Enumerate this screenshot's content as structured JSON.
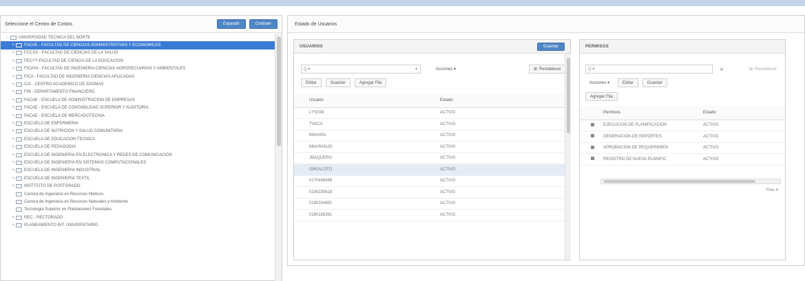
{
  "left_panel": {
    "title": "Seleccione el Centro de Costos",
    "expand_label": "Expandir",
    "collapse_label": "Contraer",
    "tree_items": [
      {
        "label": "UNIVERSIDAD TECNICA DEL NORTE",
        "toggle": "−",
        "level": 0,
        "selected": false
      },
      {
        "label": "FACAE - FACULTAD DE CIENCIAS ADMINISTRATIVAS Y ECONOMICAS",
        "toggle": "+",
        "level": 1,
        "selected": true
      },
      {
        "label": "FCCSS - FACULTAD DE CIENCIAS DE LA SALUD",
        "toggle": "+",
        "level": 1,
        "selected": false
      },
      {
        "label": "FECYT-FACULTAD DE CIENCIA DE LA EDUCACION",
        "toggle": "+",
        "level": 1,
        "selected": false
      },
      {
        "label": "FICAYA - FACULTAD DE INGENIERIA CIENCIAS AGROPECUARIAS Y AMBIENTALES",
        "toggle": "+",
        "level": 1,
        "selected": false
      },
      {
        "label": "FICA - FACULTAD DE INGENIERIA CIENCIAS APLICADAS",
        "toggle": "+",
        "level": 1,
        "selected": false
      },
      {
        "label": "CAI - CENTRO ACADEMICO DE IDIOMAS",
        "toggle": "+",
        "level": 1,
        "selected": false
      },
      {
        "label": "FIN - DEPARTAMENTO FINANCIERO",
        "toggle": "+",
        "level": 1,
        "selected": false
      },
      {
        "label": "FACAE - ESCUELA DE ADMINISTRACION DE EMPRESAS",
        "toggle": "+",
        "level": 1,
        "selected": false
      },
      {
        "label": "FACAE - ESCUELA DE CONTABILIDAD SUPERIOR Y AUDITORIA",
        "toggle": "+",
        "level": 1,
        "selected": false
      },
      {
        "label": "FACAE - ESCUELA DE MERCADOTECNIA",
        "toggle": "+",
        "level": 1,
        "selected": false
      },
      {
        "label": "ESCUELA DE ENFERMERIA",
        "toggle": "+",
        "level": 1,
        "selected": false
      },
      {
        "label": "ESCUELA DE NUTRICION Y SALUD COMUNITARIA",
        "toggle": "+",
        "level": 1,
        "selected": false
      },
      {
        "label": "ESCUELA DE EDUCACION TECNICA",
        "toggle": "+",
        "level": 1,
        "selected": false
      },
      {
        "label": "ESCUELA DE PEDAGOGIA",
        "toggle": "+",
        "level": 1,
        "selected": false
      },
      {
        "label": "ESCUELA DE INGENIERIA EN ELECTRONICA Y REDES DE COMUNICACION",
        "toggle": "+",
        "level": 1,
        "selected": false
      },
      {
        "label": "ESCUELA DE INGENIERIA EN SISTEMAS COMPUTACIONALES",
        "toggle": "+",
        "level": 1,
        "selected": false
      },
      {
        "label": "ESCUELA DE INGENIERIA INDUSTRIAL",
        "toggle": "+",
        "level": 1,
        "selected": false
      },
      {
        "label": "ESCUELA DE INGENIERIA TEXTIL",
        "toggle": "+",
        "level": 1,
        "selected": false
      },
      {
        "label": "INSTITUTO DE POSTGRADO",
        "toggle": "+",
        "level": 1,
        "selected": false
      },
      {
        "label": "Carrera de Ingenieria en Recursos Hidricos",
        "toggle": "",
        "level": 1,
        "selected": false
      },
      {
        "label": "Carrera de Ingenieria en Recursos Naturales y Ambiente",
        "toggle": "",
        "level": 1,
        "selected": false
      },
      {
        "label": "Tecnologia Superior en Plantaciones Forestales",
        "toggle": "",
        "level": 1,
        "selected": false
      },
      {
        "label": "REC - RECTORADO",
        "toggle": "+",
        "level": 1,
        "selected": false
      },
      {
        "label": "PLANEAMIENTO INT. UNIVERSITARIO",
        "toggle": "+",
        "level": 1,
        "selected": false
      }
    ]
  },
  "right_panel": {
    "title": "Estado de Usuarios"
  },
  "users_card": {
    "title": "USUARIOS",
    "header_button": "Guardar",
    "search_prefix": "Q ▾",
    "search_value": "",
    "search_dropdown": "▾",
    "actions_label": "Acciones ▾",
    "refresh_label": "Restablecer",
    "edit_label": "Editar",
    "save_label": "Guardar",
    "add_row_label": "Agregar Fila",
    "columns": [
      "Usuario",
      "Estado"
    ],
    "rows": [
      {
        "user": "LYSIGB",
        "state": "ACTIVO",
        "highlight": false
      },
      {
        "user": "TVACA",
        "state": "ACTIVO",
        "highlight": false
      },
      {
        "user": "MAVARA",
        "state": "ACTIVO",
        "highlight": false
      },
      {
        "user": "MNARANJO",
        "state": "ACTIVO",
        "highlight": false
      },
      {
        "user": "JBAQUERO",
        "state": "ACTIVO",
        "highlight": false
      },
      {
        "user": "GREALOTO",
        "state": "ACTIVO",
        "highlight": true
      },
      {
        "user": "0170448469",
        "state": "ACTIVO",
        "highlight": false
      },
      {
        "user": "0190235618",
        "state": "ACTIVO",
        "highlight": false
      },
      {
        "user": "0190334891",
        "state": "ACTIVO",
        "highlight": false
      },
      {
        "user": "0190188391",
        "state": "ACTIVO",
        "highlight": false
      }
    ]
  },
  "perms_card": {
    "title": "PERMISOS",
    "search_prefix": "Q ▾",
    "search_value": "",
    "refresh_label": "Restablecer",
    "actions_label": "Acciones ▾",
    "edit_label": "Editar",
    "save_label": "Guardar",
    "add_row_label": "Agregar Fila",
    "columns": [
      "Permisos",
      "Estado"
    ],
    "rows": [
      {
        "perm": "EJECUCION DE PLANIFICACION",
        "state": "ACTIVO"
      },
      {
        "perm": "GENERACION DE REPORTES",
        "state": "ACTIVO"
      },
      {
        "perm": "APROBACION DE REQUERIMIEN",
        "state": "ACTIVO"
      },
      {
        "perm": "REGISTRO DE NUEVA PLANIFIC",
        "state": "ACTIVO"
      }
    ],
    "footer": "Filas 4"
  },
  "colors": {
    "accent": "#3a7bd5",
    "button_blue": "#4f86c6",
    "top_bar": "#c5d3e6"
  }
}
